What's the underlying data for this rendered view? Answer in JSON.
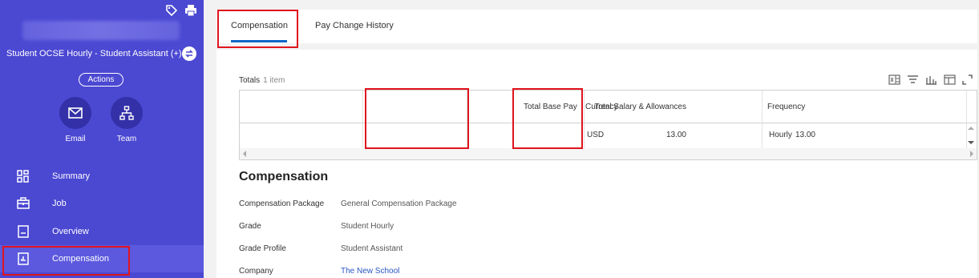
{
  "sidebar": {
    "worker_title": "Student OCSE Hourly - Student Assistant (+)",
    "actions_label": "Actions",
    "quick_actions": [
      {
        "label": "Email",
        "icon": "envelope-icon"
      },
      {
        "label": "Team",
        "icon": "org-chart-icon"
      }
    ],
    "nav": [
      {
        "label": "Summary",
        "icon": "grid-icon"
      },
      {
        "label": "Job",
        "icon": "briefcase-icon"
      },
      {
        "label": "Overview",
        "icon": "document-icon"
      },
      {
        "label": "Compensation",
        "icon": "compensation-icon",
        "active": true
      }
    ]
  },
  "tabs": [
    {
      "label": "Compensation",
      "active": true
    },
    {
      "label": "Pay Change History",
      "active": false
    }
  ],
  "totals": {
    "label": "Totals",
    "count": "1 item",
    "columns": [
      "Total Salary & Allowances",
      "Total Base Pay",
      "Currency",
      "Frequency"
    ],
    "rows": [
      [
        "13.00",
        "13.00",
        "USD",
        "Hourly"
      ]
    ]
  },
  "compensation": {
    "title": "Compensation",
    "fields": [
      {
        "label": "Compensation Package",
        "value": "General Compensation Package"
      },
      {
        "label": "Grade",
        "value": "Student Hourly"
      },
      {
        "label": "Grade Profile",
        "value": "Student Assistant"
      },
      {
        "label": "Company",
        "value": "The New School",
        "link": true
      }
    ]
  },
  "colors": {
    "sidebar_bg": "#4b48d2",
    "highlight_box": "#e0141e",
    "tab_underline": "#0a66c8",
    "link": "#2a55c4"
  }
}
